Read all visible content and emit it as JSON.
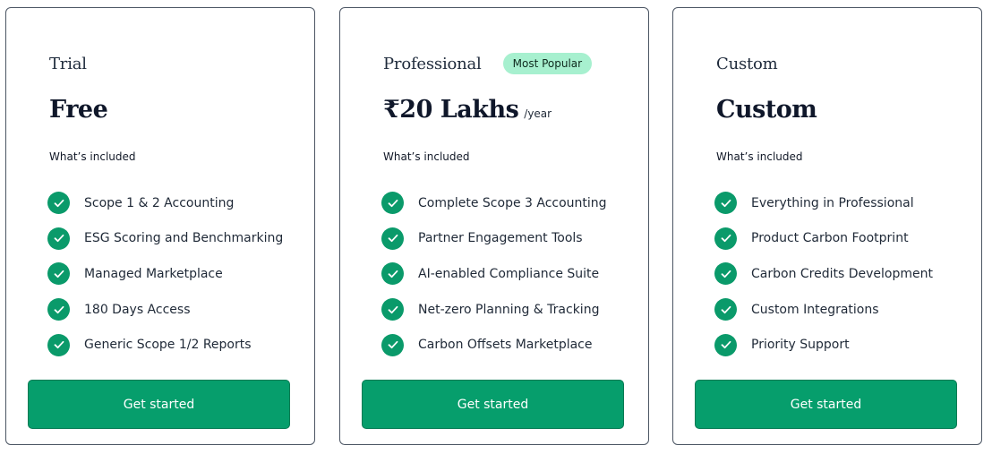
{
  "plans": [
    {
      "name": "Trial",
      "badge": "",
      "price": "Free",
      "per": "",
      "included_heading": "What’s included",
      "features": [
        "Scope 1 & 2 Accounting",
        "ESG Scoring and Benchmarking",
        "Managed Marketplace",
        "180 Days Access",
        "Generic Scope 1/2 Reports"
      ],
      "cta": "Get started"
    },
    {
      "name": "Professional",
      "badge": "Most Popular",
      "price": "₹20 Lakhs",
      "per": "/year",
      "included_heading": "What’s included",
      "features": [
        "Complete Scope 3 Accounting",
        "Partner Engagement Tools",
        "AI-enabled Compliance Suite",
        "Net-zero Planning & Tracking",
        "Carbon Offsets Marketplace"
      ],
      "cta": "Get started"
    },
    {
      "name": "Custom",
      "badge": "",
      "price": "Custom",
      "per": "",
      "included_heading": "What’s included",
      "features": [
        "Everything in Professional",
        "Product Carbon Footprint",
        "Carbon Credits Development",
        "Custom Integrations",
        "Priority Support"
      ],
      "cta": "Get started"
    }
  ],
  "icons": {
    "feature": "check-circle-icon"
  },
  "colors": {
    "accent": "#069e6c",
    "check": "#0a9a6a",
    "badge_bg": "#a7f0cf",
    "border": "#4b5563"
  }
}
